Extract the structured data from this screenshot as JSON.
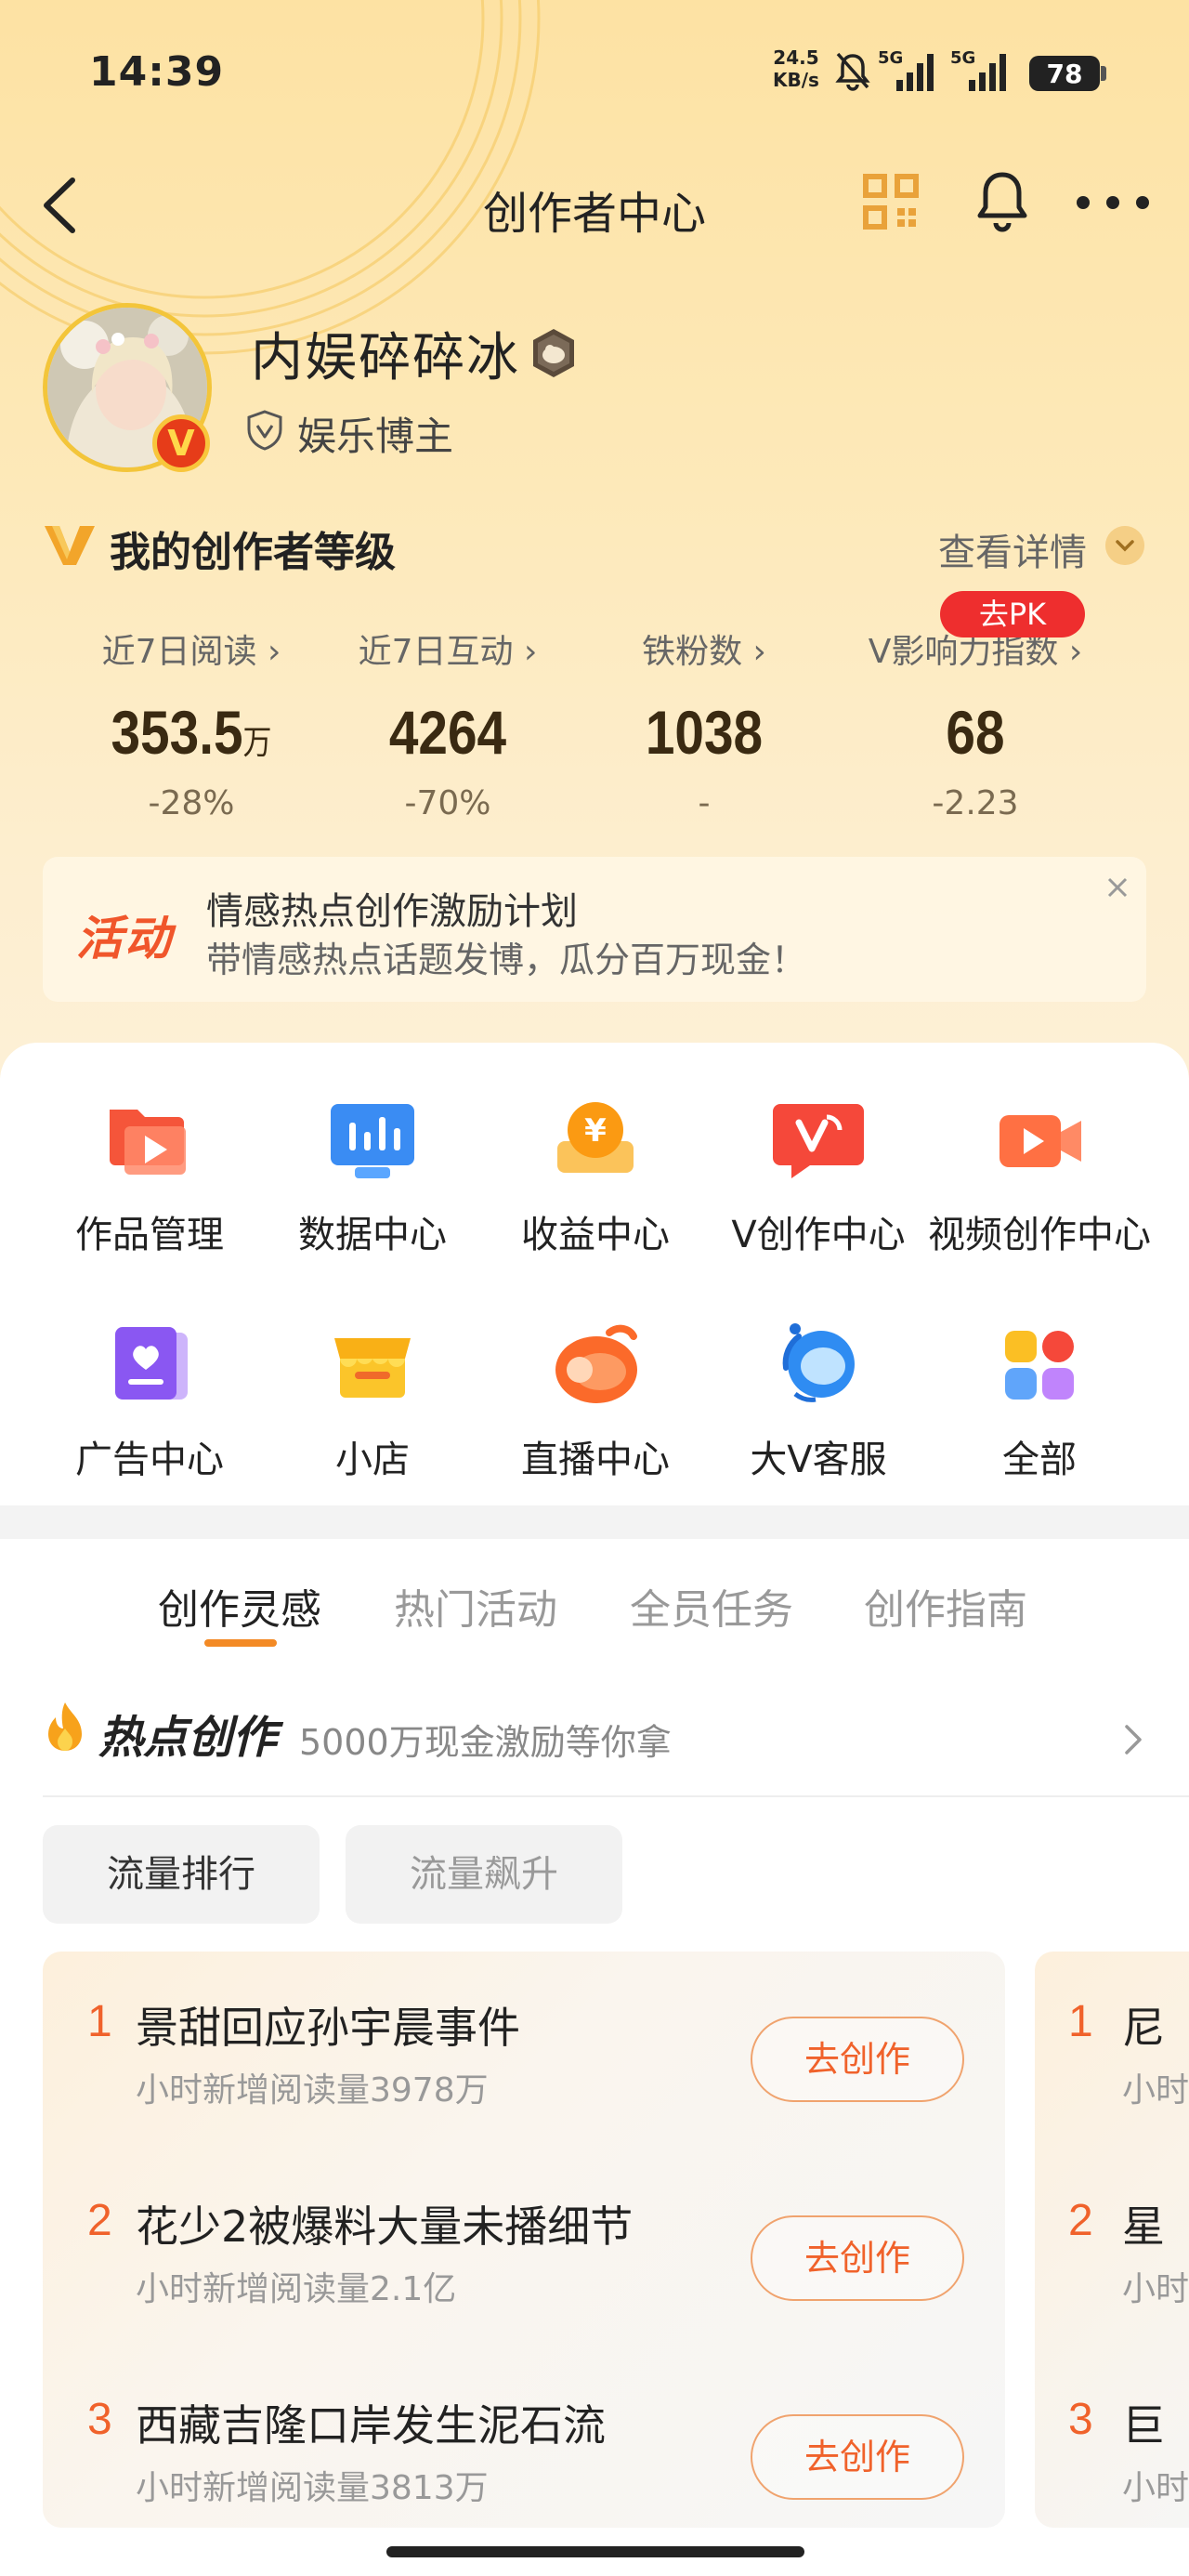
{
  "status_bar": {
    "time": "14:39",
    "speed_value": "24.5",
    "speed_unit": "KB/s",
    "signal1": "5G",
    "signal2": "5G",
    "battery": "78"
  },
  "nav": {
    "title": "创作者中心"
  },
  "profile": {
    "name": "内娱碎碎冰",
    "badge": "V",
    "tag": "娱乐博主"
  },
  "level": {
    "title": "我的创作者等级",
    "detail": "查看详情"
  },
  "stats": [
    {
      "label": "近7日阅读 ›",
      "value": "353.5",
      "unit": "万",
      "change": "-28%"
    },
    {
      "label": "近7日互动 ›",
      "value": "4264",
      "unit": "",
      "change": "-70%"
    },
    {
      "label": "铁粉数 ›",
      "value": "1038",
      "unit": "",
      "change": "-"
    },
    {
      "label": "V影响力指数 ›",
      "value": "68",
      "unit": "",
      "change": "-2.23"
    }
  ],
  "pk_badge": "去PK",
  "banner": {
    "badge": "活动",
    "title": "情感热点创作激励计划",
    "subtitle": "带情感热点话题发博，瓜分百万现金！"
  },
  "tools": [
    {
      "label": "作品管理"
    },
    {
      "label": "数据中心"
    },
    {
      "label": "收益中心"
    },
    {
      "label": "V创作中心"
    },
    {
      "label": "视频创作中心"
    },
    {
      "label": "广告中心"
    },
    {
      "label": "小店"
    },
    {
      "label": "直播中心"
    },
    {
      "label": "大V客服"
    },
    {
      "label": "全部"
    }
  ],
  "tabs": [
    {
      "label": "创作灵感"
    },
    {
      "label": "热门活动"
    },
    {
      "label": "全员任务"
    },
    {
      "label": "创作指南"
    }
  ],
  "hot": {
    "title": "热点创作",
    "subtitle": "5000万现金激励等你拿"
  },
  "filters": [
    {
      "label": "流量排行"
    },
    {
      "label": "流量飙升"
    }
  ],
  "ranking": [
    {
      "rank": "1",
      "title": "景甜回应孙宇晨事件",
      "sub": "小时新增阅读量3978万",
      "button": "去创作"
    },
    {
      "rank": "2",
      "title": "花少2被爆料大量未播细节",
      "sub": "小时新增阅读量2.1亿",
      "button": "去创作"
    },
    {
      "rank": "3",
      "title": "西藏吉隆口岸发生泥石流",
      "sub": "小时新增阅读量3813万",
      "button": "去创作"
    }
  ],
  "ranking2": [
    {
      "rank": "1",
      "title": "尼",
      "sub": "小时"
    },
    {
      "rank": "2",
      "title": "星",
      "sub": "小时"
    },
    {
      "rank": "3",
      "title": "巨",
      "sub": "小时"
    }
  ]
}
